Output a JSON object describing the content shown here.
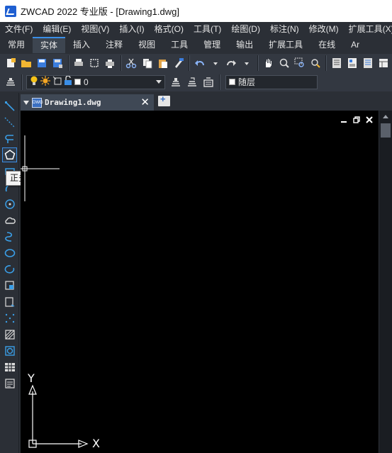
{
  "window": {
    "title": "ZWCAD 2022 专业版 - [Drawing1.dwg]"
  },
  "menu": [
    "文件(F)",
    "编辑(E)",
    "视图(V)",
    "插入(I)",
    "格式(O)",
    "工具(T)",
    "绘图(D)",
    "标注(N)",
    "修改(M)",
    "扩展工具(X)"
  ],
  "ribbon_tabs": [
    {
      "label": "常用",
      "active": false
    },
    {
      "label": "实体",
      "active": true
    },
    {
      "label": "插入",
      "active": false
    },
    {
      "label": "注释",
      "active": false
    },
    {
      "label": "视图",
      "active": false
    },
    {
      "label": "工具",
      "active": false
    },
    {
      "label": "管理",
      "active": false
    },
    {
      "label": "输出",
      "active": false
    },
    {
      "label": "扩展工具",
      "active": false
    },
    {
      "label": "在线",
      "active": false
    },
    {
      "label": "Ar",
      "active": false
    }
  ],
  "layer_toolbar": {
    "current_layer": "0",
    "color_value": "随层"
  },
  "document_tab": {
    "label": "Drawing1.dwg"
  },
  "tooltip": {
    "text": "正多边形"
  },
  "ucs": {
    "x_label": "X",
    "y_label": "Y"
  },
  "icons": {
    "toolbar1": [
      "new-icon",
      "open-icon",
      "save-icon",
      "save-as-icon",
      "print-icon",
      "print-preview-icon",
      "publish-icon",
      "cut-icon",
      "copy-icon",
      "paste-icon",
      "match-properties-icon",
      "undo-icon",
      "redo-icon",
      "pan-icon",
      "zoom-realtime-icon",
      "zoom-window-icon",
      "zoom-previous-icon",
      "properties-icon",
      "design-center-icon",
      "tool-palette-icon",
      "sheet-set-icon"
    ],
    "left": [
      "line-icon",
      "construction-line-icon",
      "polyline-icon",
      "polygon-icon",
      "rectangle-icon",
      "arc-icon",
      "circle-icon",
      "revision-cloud-icon",
      "spline-icon",
      "ellipse-icon",
      "ellipse-arc-icon",
      "insert-block-icon",
      "make-block-icon",
      "point-icon",
      "hatch-icon",
      "region-icon",
      "table-icon",
      "multiline-text-icon"
    ]
  },
  "colors": {
    "accent": "#3a8ee6",
    "background": "#2b2f36",
    "canvas": "#000000"
  }
}
